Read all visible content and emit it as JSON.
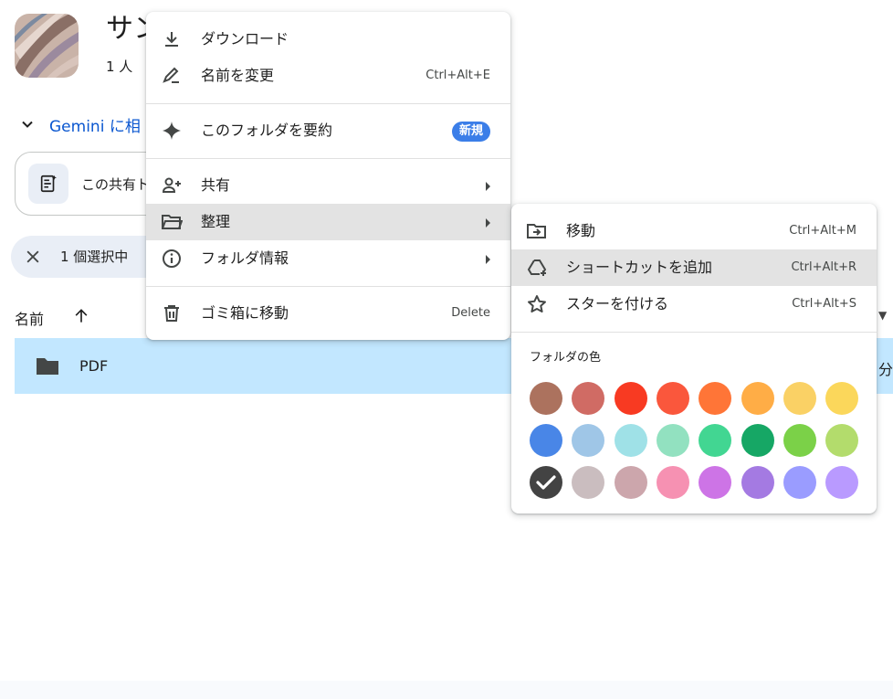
{
  "header": {
    "title": "サン",
    "member_count": "1 人"
  },
  "gemini": {
    "label": "Gemini に相"
  },
  "summary_card": {
    "text": "この共有ト"
  },
  "selection_bar": {
    "count": "1 個選択中"
  },
  "file_list": {
    "column_name": "名前",
    "rows": [
      {
        "name": "PDF",
        "modified_fragment": "分"
      }
    ]
  },
  "context_menu": {
    "items": [
      {
        "icon": "download-icon",
        "label": "ダウンロード",
        "shortcut": ""
      },
      {
        "icon": "rename-icon",
        "label": "名前を変更",
        "shortcut": "Ctrl+Alt+E"
      },
      {
        "icon": "sparkle-icon",
        "label": "このフォルダを要約",
        "badge": "新規"
      },
      {
        "icon": "share-icon",
        "label": "共有"
      },
      {
        "icon": "folder-open-icon",
        "label": "整理"
      },
      {
        "icon": "info-icon",
        "label": "フォルダ情報"
      },
      {
        "icon": "trash-icon",
        "label": "ゴミ箱に移動",
        "shortcut": "Delete"
      }
    ]
  },
  "organize_submenu": {
    "items": [
      {
        "icon": "move-icon",
        "label": "移動",
        "shortcut": "Ctrl+Alt+M"
      },
      {
        "icon": "add-shortcut-icon",
        "label": "ショートカットを追加",
        "shortcut": "Ctrl+Alt+R"
      },
      {
        "icon": "star-icon",
        "label": "スターを付ける",
        "shortcut": "Ctrl+Alt+S"
      }
    ],
    "folder_color_heading": "フォルダの色",
    "colors": [
      "#ac725e",
      "#d06b64",
      "#f83a22",
      "#fa573c",
      "#ff7537",
      "#ffad46",
      "#fad165",
      "#fbd75b",
      "#4986e7",
      "#9fc6e7",
      "#9fe1e7",
      "#92e1c0",
      "#42d692",
      "#16a765",
      "#7bd148",
      "#b3dc6c",
      "#434343",
      "#cabdbf",
      "#cca6ac",
      "#f691b2",
      "#cd74e6",
      "#a47ae2",
      "#9a9cff",
      "#b99aff"
    ],
    "selected_color": "#434343"
  }
}
